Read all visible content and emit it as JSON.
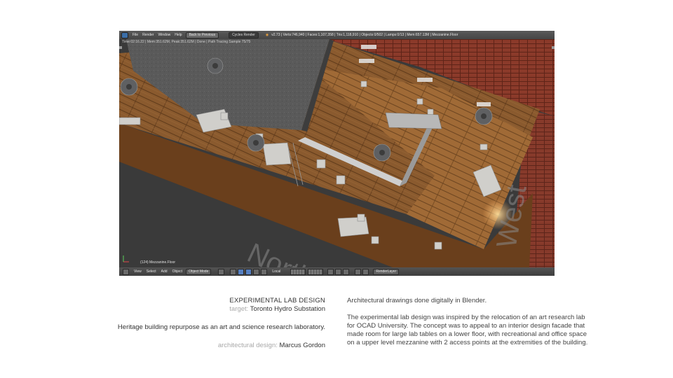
{
  "blender": {
    "menu": [
      "File",
      "Render",
      "Window",
      "Help"
    ],
    "back_button": "Back to Previous",
    "engine": "Cycles Render",
    "stats": "v2.73 | Verts:746,940 | Faces:1,107,358 | Tris:1,118,910 | Objects:0/502 | Lamps:0/13 | Mem:657.13M | Mezzanine.Floor",
    "render_status": "Time:02:16.22 | Mem:351.62M, Peak:351.62M | Done | Path Tracing Sample 75/75",
    "viewport_label": "(124) Mezzanine.Floor",
    "scene_labels": [
      "North",
      "West"
    ],
    "bottom_menu": [
      "View",
      "Select",
      "Add",
      "Object"
    ],
    "mode": "Object Mode",
    "pivot": "Local",
    "render_layer": "RenderLayer",
    "colors": {
      "ui_dark": "#3b3b3b",
      "wood": "#8a5a2e",
      "brick": "#8b3a2a",
      "roof_gray": "#5a5a5a",
      "highlight_blue": "#5680c2"
    }
  },
  "caption": {
    "title": "EXPERIMENTAL LAB DESIGN",
    "target_label": "target:",
    "target_value": "Toronto Hydro Substation",
    "subtitle": "Heritage building repurpose as an art and science research laboratory.",
    "designer_label": "architectural design:",
    "designer_value": "Marcus Gordon",
    "intro": "Architectural drawings done digitally in Blender.",
    "description": "The experimental lab design was inspired by the relocation of an art research lab for OCAD University.  The concept was to appeal to an interior design facade that made room for large lab tables on a lower floor, with recreational and office space on a upper level mezzanine with 2 access points at the extremities of the building."
  }
}
